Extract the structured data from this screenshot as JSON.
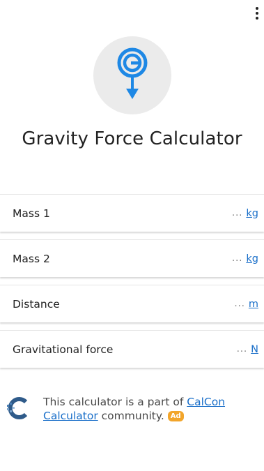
{
  "header": {
    "title": "Gravity Force Calculator"
  },
  "rows": [
    {
      "label": "Mass 1",
      "placeholder": "...",
      "unit": "kg"
    },
    {
      "label": "Mass 2",
      "placeholder": "...",
      "unit": "kg"
    },
    {
      "label": "Distance",
      "placeholder": "...",
      "unit": "m"
    },
    {
      "label": "Gravitational force",
      "placeholder": "...",
      "unit": "N"
    }
  ],
  "footer": {
    "text_before": "This calculator is a part of ",
    "link": "CalCon Calculator",
    "text_after": " community.",
    "badge": "Ad"
  },
  "colors": {
    "accent": "#1a6fc9",
    "logo_blue": "#1e88e5",
    "badge": "#f2a52b",
    "logo_bg": "#ebebeb"
  },
  "icons": {
    "menu": "more-vertical-icon",
    "logo": "gravity-g-arrow-icon",
    "footer": "calcon-logo-icon"
  }
}
